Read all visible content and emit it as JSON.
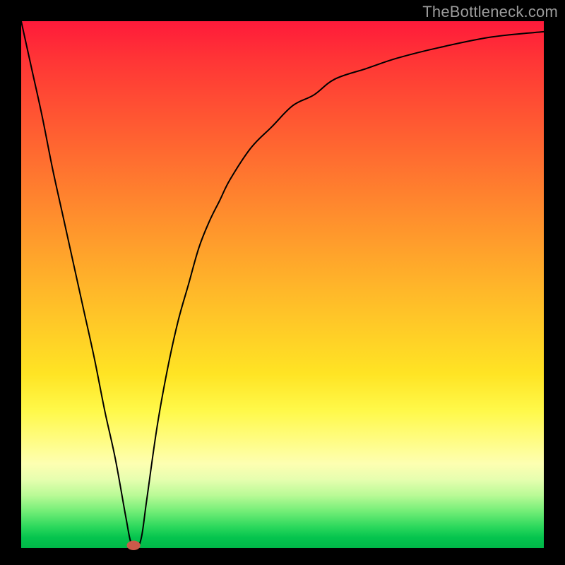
{
  "watermark": "TheBottleneck.com",
  "colors": {
    "frame": "#000000",
    "curve": "#000000",
    "marker": "#cc5a4a",
    "gradient_top": "#ff1a3a",
    "gradient_bottom": "#00b748"
  },
  "chart_data": {
    "type": "line",
    "title": "",
    "xlabel": "",
    "ylabel": "",
    "xlim": [
      0,
      100
    ],
    "ylim": [
      0,
      100
    ],
    "grid": false,
    "legend": false,
    "annotations": [
      "TheBottleneck.com"
    ],
    "series": [
      {
        "name": "bottleneck-curve",
        "x": [
          0,
          2,
          4,
          6,
          8,
          10,
          12,
          14,
          16,
          18,
          20,
          21,
          22,
          23,
          24,
          26,
          28,
          30,
          32,
          34,
          36,
          38,
          40,
          44,
          48,
          52,
          56,
          60,
          66,
          72,
          80,
          90,
          100
        ],
        "y": [
          100,
          91,
          82,
          72,
          63,
          54,
          45,
          36,
          26,
          17,
          6,
          1,
          0,
          2,
          9,
          23,
          34,
          43,
          50,
          57,
          62,
          66,
          70,
          76,
          80,
          84,
          86,
          89,
          91,
          93,
          95,
          97,
          98
        ]
      }
    ],
    "marker": {
      "x": 21.5,
      "y": 0.5,
      "rx": 1.3,
      "ry": 0.9
    }
  }
}
